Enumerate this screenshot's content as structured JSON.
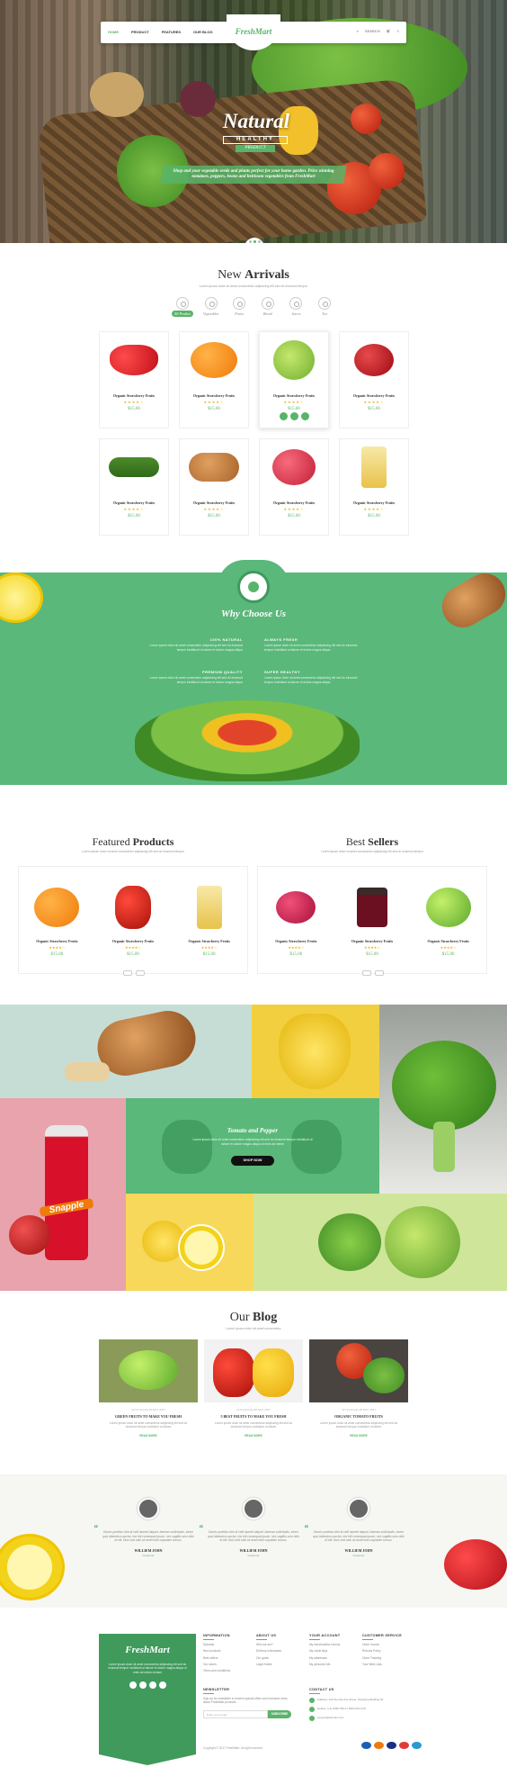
{
  "nav": {
    "menu": [
      "HOME",
      "PRODUCT",
      "FEATURES",
      "OUR BLOG"
    ],
    "logo": "FreshMart",
    "search": "SEARCH"
  },
  "hero": {
    "title": "Natural",
    "sub1": "HEALTHY",
    "sub2": "PRODUCT",
    "text": "Shop and your vegetable seeds and plants perfect for your home garden. Price winning tomatoes, peppers, beans and heirloom vegetables from FreshMart"
  },
  "arrivals": {
    "title_light": "New",
    "title_bold": "Arrivals",
    "subtitle": "Lorem ipsum dolor sit amet consectetur adipiscing elit sed do eiusmod tempor",
    "filters": [
      "All Product",
      "Vegetables",
      "Fruits",
      "Bread",
      "Juices",
      "Tea"
    ],
    "products": [
      {
        "name": "Organic Strawberry Fruits",
        "stars": "★★★★☆",
        "price": "$15.00"
      },
      {
        "name": "Organic Strawberry Fruits",
        "stars": "★★★★☆",
        "price": "$15.00"
      },
      {
        "name": "Organic Strawberry Fruits",
        "stars": "★★★★☆",
        "price": "$15.00"
      },
      {
        "name": "Organic Strawberry Fruits",
        "stars": "★★★★☆",
        "price": "$15.00"
      },
      {
        "name": "Organic Strawberry Fruits",
        "stars": "★★★★☆",
        "price": "$15.00"
      },
      {
        "name": "Organic Strawberry Fruits",
        "stars": "★★★★☆",
        "price": "$15.00"
      },
      {
        "name": "Organic Strawberry Fruits",
        "stars": "★★★★☆",
        "price": "$15.00"
      },
      {
        "name": "Organic Strawberry Fruits",
        "stars": "★★★★☆",
        "price": "$15.00"
      }
    ]
  },
  "why": {
    "title": "Why Choose Us",
    "boxes": [
      {
        "h": "100% NATURAL",
        "t": "Lorem ipsum dolor sit amet consectetur adipisicing elit sed do eiusmod tempor incididunt ut labore et dolore magna aliqua"
      },
      {
        "h": "ALWAYS FRESH",
        "t": "Lorem ipsum dolor sit amet consectetur adipisicing elit sed do eiusmod tempor incididunt ut labore et dolore magna aliqua"
      },
      {
        "h": "PREMIUM QUALITY",
        "t": "Lorem ipsum dolor sit amet consectetur adipisicing elit sed do eiusmod tempor incididunt ut labore et dolore magna aliqua"
      },
      {
        "h": "SUPER HEALTHY",
        "t": "Lorem ipsum dolor sit amet consectetur adipisicing elit sed do eiusmod tempor incididunt ut labore et dolore magna aliqua"
      }
    ]
  },
  "featured": {
    "title_light": "Featured",
    "title_bold": "Products",
    "subtitle": "Lorem ipsum dolor sit amet consectetur adipiscing elit sed do eiusmod tempor",
    "items": [
      {
        "name": "Organic Strawberry Fruits",
        "stars": "★★★★☆",
        "price": "$15.00"
      },
      {
        "name": "Organic Strawberry Fruits",
        "stars": "★★★★☆",
        "price": "$15.00"
      },
      {
        "name": "Organic Strawberry Fruits",
        "stars": "★★★★☆",
        "price": "$15.00"
      }
    ]
  },
  "best": {
    "title_light": "Best",
    "title_bold": "Sellers",
    "subtitle": "Lorem ipsum dolor sit amet consectetur adipiscing elit sed do eiusmod tempor",
    "items": [
      {
        "name": "Organic Strawberry Fruits",
        "stars": "★★★★☆",
        "price": "$15.00"
      },
      {
        "name": "Organic Strawberry Fruits",
        "stars": "★★★★☆",
        "price": "$15.00"
      },
      {
        "name": "Organic Strawberry Fruits",
        "stars": "★★★★☆",
        "price": "$15.00"
      }
    ]
  },
  "promo": {
    "title": "Tomato and Pepper",
    "text": "Lorem ipsum dolor sit amet consectetur adipisicing elit sed do eiusmod tempor incididunt ut labore et dolore magna aliqua ut enim ad minim",
    "button": "SHOP NOW",
    "brand": "Snapple"
  },
  "blog": {
    "title_light": "Our",
    "title_bold": "Blog",
    "subtitle": "Lorem ipsum dolor sit amet consectetur",
    "posts": [
      {
        "meta": "12 Comments   20 April, 2017",
        "title": "GREEN FRUITS TO MAKE YOU FRESH",
        "text": "Lorem ipsum dolor sit amet consectetur adipiscing elit sed do eiusmod tempor incididunt ut labore",
        "more": "READ MORE"
      },
      {
        "meta": "12 Comments   20 April, 2017",
        "title": "5 BEST FRUITS TO MAKE YOU FRESH",
        "text": "Lorem ipsum dolor sit amet consectetur adipiscing elit sed do eiusmod tempor incididunt ut labore",
        "more": "READ MORE"
      },
      {
        "meta": "12 Comments   20 April, 2017",
        "title": "ORGANIC TOMATO FRUITS",
        "text": "Lorem ipsum dolor sit amet consectetur adipiscing elit sed do eiusmod tempor incididunt ut labore",
        "more": "READ MORE"
      }
    ]
  },
  "testimonials": [
    {
      "quote": "Donec porttitor nibh id velit laoreet aliquet. Aenean sollicitudin, lorem quis bibendum auctor, nisi elit consequat ipsum, nec sagittis sem nibh id elit. Duis sed odio sit amet nibh vulputate cursus.",
      "name": "WILLIEM JOHN",
      "role": "Customer"
    },
    {
      "quote": "Donec porttitor nibh id velit laoreet aliquet. Aenean sollicitudin, lorem quis bibendum auctor, nisi elit consequat ipsum, nec sagittis sem nibh id elit. Duis sed odio sit amet nibh vulputate cursus.",
      "name": "WILLIEM JOHN",
      "role": "Customer"
    },
    {
      "quote": "Donec porttitor nibh id velit laoreet aliquet. Aenean sollicitudin, lorem quis bibendum auctor, nisi elit consequat ipsum, nec sagittis sem nibh id elit. Duis sed odio sit amet nibh vulputate cursus.",
      "name": "WILLIEM JOHN",
      "role": "Customer"
    }
  ],
  "footer": {
    "logo": "FreshMart",
    "about": "Lorem ipsum dolor sit amet consectetur adipiscing elit sed do eiusmod tempor incididunt ut labore et dolore magna aliqua ut enim ad minim veniam",
    "info": {
      "h": "INFORMATION",
      "items": [
        "Specials",
        "New products",
        "Best sellers",
        "Our stores",
        "Terms and conditions"
      ]
    },
    "aboutus": {
      "h": "ABOUT US",
      "items": [
        "Who we are?",
        "Delivery information",
        "Our guide",
        "Legal Notice"
      ]
    },
    "account": {
      "h": "YOUR ACCOUNT",
      "items": [
        "My merchandise returns",
        "My credit slips",
        "My addresses",
        "My personal info"
      ]
    },
    "service": {
      "h": "CUSTOMER SERVICE",
      "items": [
        "Order Invoice",
        "Returns Policy",
        "Order Tracking",
        "Your Wish Lists"
      ]
    },
    "newsletter": {
      "h": "NEWSLETTER",
      "text": "Sign up for newsletter to receive special offers and exclusive news about FreshMart products",
      "placeholder": "Enter your email",
      "button": "SUBSCRIBE"
    },
    "contact": {
      "h": "CONTACT US",
      "address": "Address: 123 Sunrise Ave Street, Shopping Building 5F",
      "phone": "Hotline: (+1) 0456 789 9 / 0000 010 0 00",
      "email": "support@domain.com"
    },
    "copyright": "Copyright © 2017 FreshMart. All right reserved."
  }
}
